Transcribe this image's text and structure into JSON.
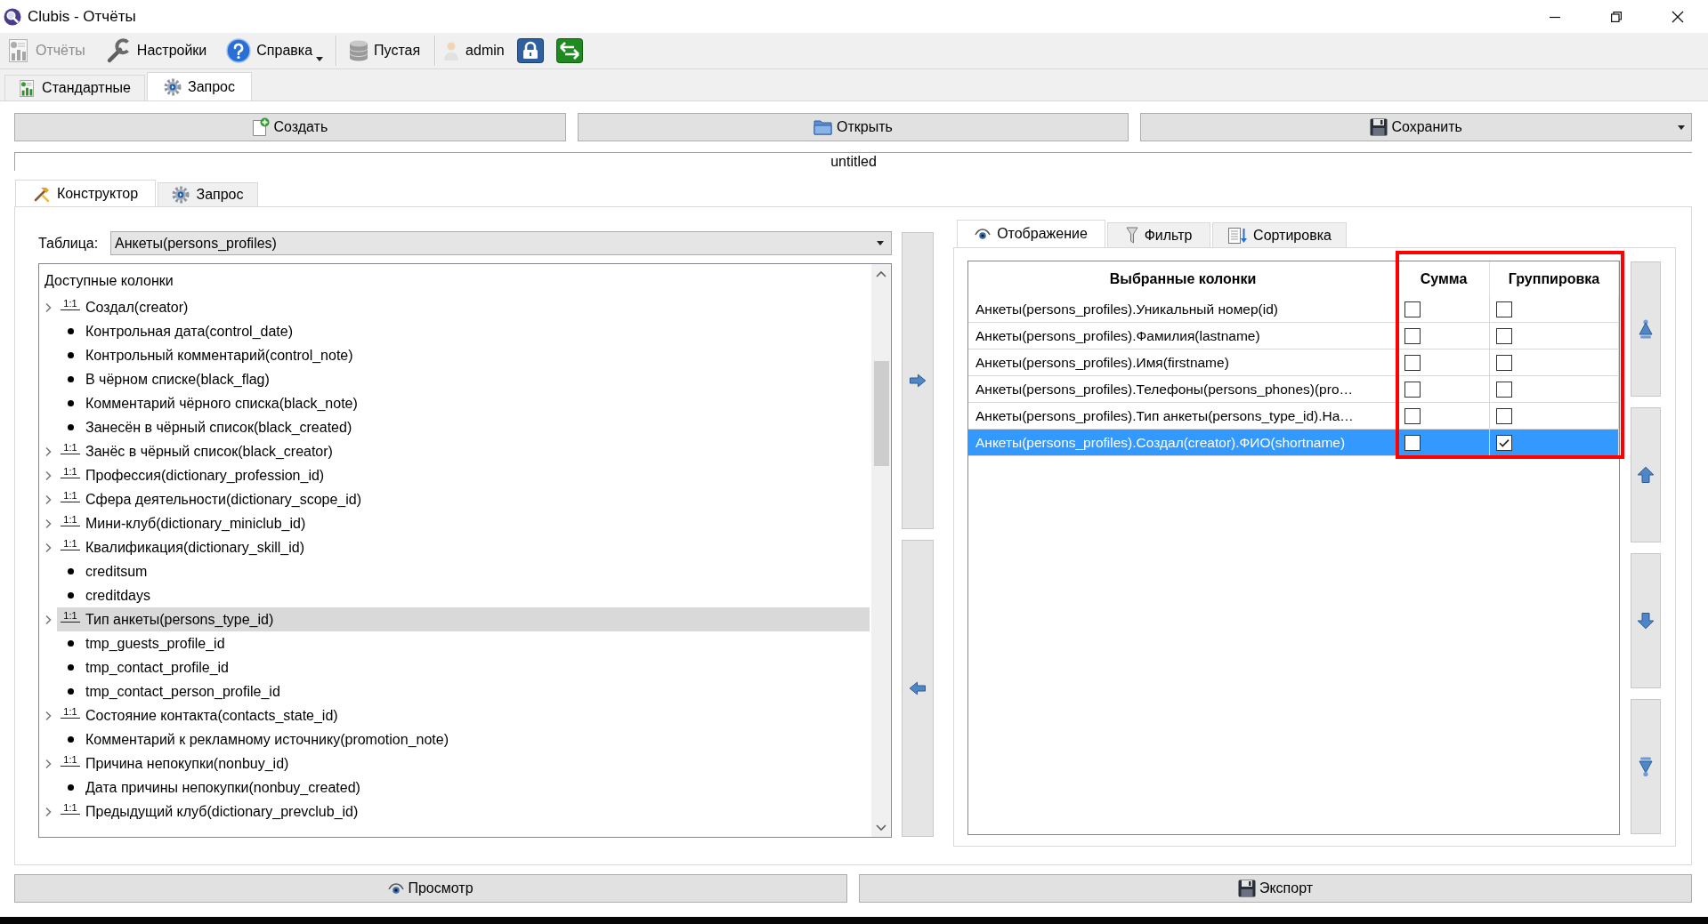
{
  "window": {
    "title": "Clubis - Отчёты"
  },
  "toolbar": [
    {
      "items": [
        {
          "kind": "button",
          "label": "Отчёты",
          "disabled": true
        },
        {
          "kind": "button",
          "label": "Настройки",
          "disabled": false
        },
        {
          "kind": "menu",
          "label": "Справка",
          "disabled": false
        }
      ]
    },
    {
      "items": [
        {
          "kind": "button",
          "label": "Пустая",
          "disabled": false
        }
      ]
    },
    {
      "items": [
        {
          "kind": "label",
          "label": "admin"
        },
        {
          "kind": "icon-button",
          "disabled": false
        },
        {
          "kind": "icon-button",
          "disabled": false
        }
      ]
    }
  ],
  "main_tabs": [
    {
      "label": "Стандартные",
      "selected": false
    },
    {
      "label": "Запрос",
      "selected": true
    }
  ],
  "actions": [
    {
      "kind": "plain",
      "label": "Создать"
    },
    {
      "kind": "plain",
      "label": "Открыть"
    },
    {
      "kind": "split",
      "label": "Сохранить"
    }
  ],
  "document": {
    "title": "untitled"
  },
  "builder_tabs": [
    {
      "label": "Конструктор",
      "selected": true
    },
    {
      "label": "Запрос",
      "selected": false
    }
  ],
  "table_picker": {
    "label": "Таблица:",
    "value": "Анкеты(persons_profiles)"
  },
  "available_columns": {
    "title": "Доступные колонки",
    "items": [
      {
        "kind": "relation",
        "cardinality": "1:1",
        "label": "Создал(creator)",
        "expanded": false,
        "selected": false
      },
      {
        "kind": "field",
        "label": "Контрольная дата(control_date)",
        "selected": false
      },
      {
        "kind": "field",
        "label": "Контрольный комментарий(control_note)",
        "selected": false
      },
      {
        "kind": "field",
        "label": "В чёрном списке(black_flag)",
        "selected": false
      },
      {
        "kind": "field",
        "label": "Комментарий чёрного списка(black_note)",
        "selected": false
      },
      {
        "kind": "field",
        "label": "Занесён в чёрный список(black_created)",
        "selected": false
      },
      {
        "kind": "relation",
        "cardinality": "1:1",
        "label": "Занёс в чёрный список(black_creator)",
        "expanded": false,
        "selected": false
      },
      {
        "kind": "relation",
        "cardinality": "1:1",
        "label": "Профессия(dictionary_profession_id)",
        "expanded": false,
        "selected": false
      },
      {
        "kind": "relation",
        "cardinality": "1:1",
        "label": "Сфера деятельности(dictionary_scope_id)",
        "expanded": false,
        "selected": false
      },
      {
        "kind": "relation",
        "cardinality": "1:1",
        "label": "Мини-клуб(dictionary_miniclub_id)",
        "expanded": false,
        "selected": false
      },
      {
        "kind": "relation",
        "cardinality": "1:1",
        "label": "Квалификация(dictionary_skill_id)",
        "expanded": false,
        "selected": false
      },
      {
        "kind": "field",
        "label": "creditsum",
        "selected": false
      },
      {
        "kind": "field",
        "label": "creditdays",
        "selected": false
      },
      {
        "kind": "relation",
        "cardinality": "1:1",
        "label": "Тип анкеты(persons_type_id)",
        "expanded": false,
        "selected": true
      },
      {
        "kind": "field",
        "label": "tmp_guests_profile_id",
        "selected": false
      },
      {
        "kind": "field",
        "label": "tmp_contact_profile_id",
        "selected": false
      },
      {
        "kind": "field",
        "label": "tmp_contact_person_profile_id",
        "selected": false
      },
      {
        "kind": "relation",
        "cardinality": "1:1",
        "label": "Состояние контакта(contacts_state_id)",
        "expanded": false,
        "selected": false
      },
      {
        "kind": "field",
        "label": "Комментарий к рекламному источнику(promotion_note)",
        "selected": false
      },
      {
        "kind": "relation",
        "cardinality": "1:1",
        "label": "Причина непокупки(nonbuy_id)",
        "expanded": false,
        "selected": false
      },
      {
        "kind": "field",
        "label": "Дата причины непокупки(nonbuy_created)",
        "selected": false
      },
      {
        "kind": "relation",
        "cardinality": "1:1",
        "label": "Предыдущий клуб(dictionary_prevclub_id)",
        "expanded": false,
        "selected": false
      }
    ]
  },
  "display_tabs": [
    {
      "label": "Отображение",
      "selected": true
    },
    {
      "label": "Фильтр",
      "selected": false
    },
    {
      "label": "Сортировка",
      "selected": false
    }
  ],
  "selected_columns": {
    "columns": [
      "Выбранные колонки",
      "Сумма",
      "Группировка"
    ],
    "rows": [
      {
        "name": "Анкеты(persons_profiles).Уникальный номер(id)",
        "sum": false,
        "group": false,
        "selected": false
      },
      {
        "name": "Анкеты(persons_profiles).Фамилия(lastname)",
        "sum": false,
        "group": false,
        "selected": false
      },
      {
        "name": "Анкеты(persons_profiles).Имя(firstname)",
        "sum": false,
        "group": false,
        "selected": false
      },
      {
        "name": "Анкеты(persons_profiles).Телефоны(persons_phones)(pro…",
        "sum": false,
        "group": false,
        "selected": false
      },
      {
        "name": "Анкеты(persons_profiles).Тип анкеты(persons_type_id).На…",
        "sum": false,
        "group": false,
        "selected": false
      },
      {
        "name": "Анкеты(persons_profiles).Создал(creator).ФИО(shortname)",
        "sum": false,
        "group": true,
        "selected": true
      }
    ]
  },
  "footer_buttons": [
    {
      "label": "Просмотр"
    },
    {
      "label": "Экспорт"
    }
  ]
}
